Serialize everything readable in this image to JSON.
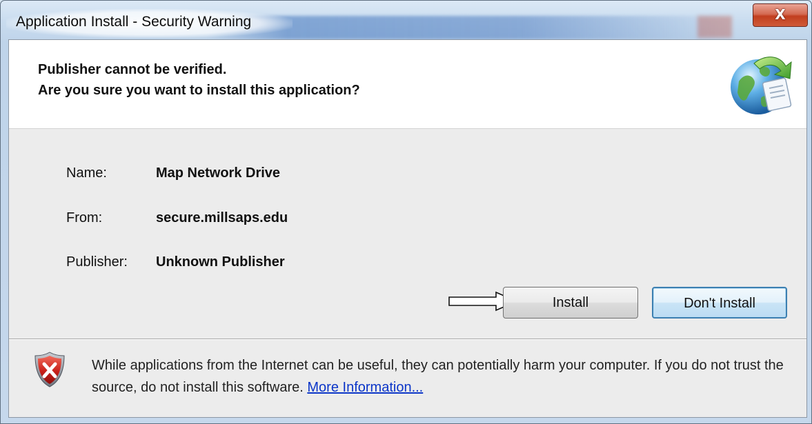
{
  "window": {
    "title": "Application Install - Security Warning",
    "close_label": "X"
  },
  "header": {
    "line1": "Publisher cannot be verified.",
    "line2": "Are you sure you want to install this application?",
    "icon": "globe-install-icon"
  },
  "details": [
    {
      "label": "Name:",
      "value": "Map Network Drive"
    },
    {
      "label": "From:",
      "value": "secure.millsaps.edu"
    },
    {
      "label": "Publisher:",
      "value": "Unknown Publisher"
    }
  ],
  "buttons": {
    "install": "Install",
    "dont_install": "Don't Install"
  },
  "annotation": {
    "icon": "arrow-right-icon"
  },
  "footer": {
    "icon": "shield-warning-icon",
    "text": "While applications from the Internet can be useful, they can potentially harm your computer. If you do not trust the source, do not install this software.",
    "link": "More Information..."
  },
  "colors": {
    "link": "#0b35c8",
    "close_button": "#c13e1e",
    "default_button_border": "#3c7fb1"
  }
}
